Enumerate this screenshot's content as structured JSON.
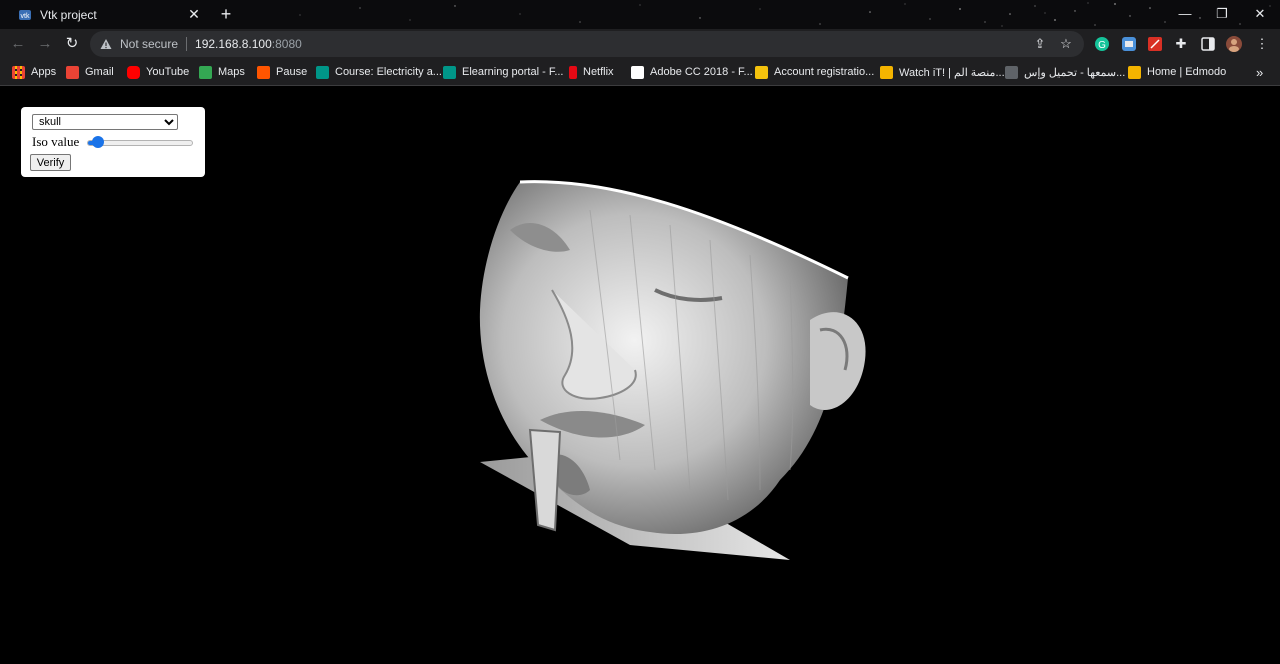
{
  "tab": {
    "title": "Vtk project"
  },
  "address": {
    "security_label": "Not secure",
    "host": "192.168.8.100",
    "port": ":8080"
  },
  "bookmarks": [
    {
      "label": "Apps",
      "icon": "apps-grid-icon",
      "color": "#ea4335"
    },
    {
      "label": "Gmail",
      "icon": "gmail-icon",
      "color": "#ea4335"
    },
    {
      "label": "YouTube",
      "icon": "youtube-icon",
      "color": "#ff0000"
    },
    {
      "label": "Maps",
      "icon": "maps-icon",
      "color": "#34a853"
    },
    {
      "label": "Pause",
      "icon": "soundcloud-icon",
      "color": "#ff5500"
    },
    {
      "label": "Course: Electricity a...",
      "icon": "course-icon",
      "color": "#009688"
    },
    {
      "label": "Elearning portal - F...",
      "icon": "elearning-icon",
      "color": "#009688"
    },
    {
      "label": "Netflix",
      "icon": "netflix-icon",
      "color": "#e50914"
    },
    {
      "label": "Adobe CC 2018 - F...",
      "icon": "adobe-icon",
      "color": "#ffffff"
    },
    {
      "label": "Account registratio...",
      "icon": "folder-icon",
      "color": "#f4c20d"
    },
    {
      "label": "Watch iT! | منصة الم...",
      "icon": "watchit-icon",
      "color": "#f4b400"
    },
    {
      "label": "سمعها - تحميل وإس...",
      "icon": "audio-icon",
      "color": "#5f6368"
    },
    {
      "label": "Home | Edmodo",
      "icon": "edmodo-icon",
      "color": "#f4b400"
    }
  ],
  "bookmarks_overflow": "»",
  "panel": {
    "dataset_selected": "skull",
    "dataset_options": [
      "skull"
    ],
    "iso_label": "Iso value",
    "iso_value": 0.1,
    "verify_label": "Verify"
  },
  "colors": {
    "accent": "#1a73e8",
    "background": "#000000",
    "toolbar": "#1f1f21"
  }
}
